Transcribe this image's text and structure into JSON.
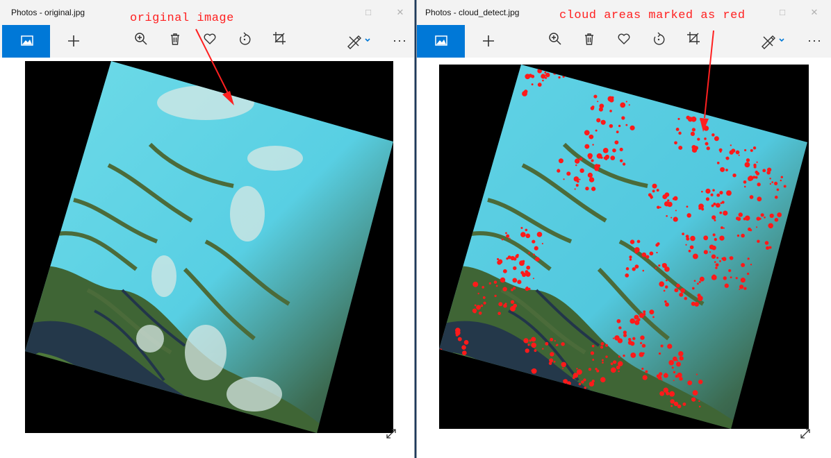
{
  "windows": [
    {
      "title": "Photos - original.jpg",
      "annotation": "original image",
      "toolbar": {
        "icons": [
          "home-picture-icon",
          "add-icon",
          "zoom-in-icon",
          "delete-icon",
          "favorite-icon",
          "rotate-icon",
          "crop-icon",
          "edit-draw-icon",
          "more-icon"
        ],
        "more_label": "···"
      }
    },
    {
      "title": "Photos - cloud_detect.jpg",
      "annotation": "cloud areas marked as red",
      "toolbar": {
        "icons": [
          "home-picture-icon",
          "add-icon",
          "zoom-in-icon",
          "delete-icon",
          "favorite-icon",
          "rotate-icon",
          "crop-icon",
          "edit-draw-icon",
          "more-icon"
        ],
        "more_label": "···"
      }
    }
  ],
  "colors": {
    "accent": "#0078d7",
    "annotation": "#ff2020",
    "cloud_mark": "#ff1a1a",
    "ice": "#4fd6e8",
    "forest": "#4a6b3a",
    "water": "#1f3345"
  }
}
